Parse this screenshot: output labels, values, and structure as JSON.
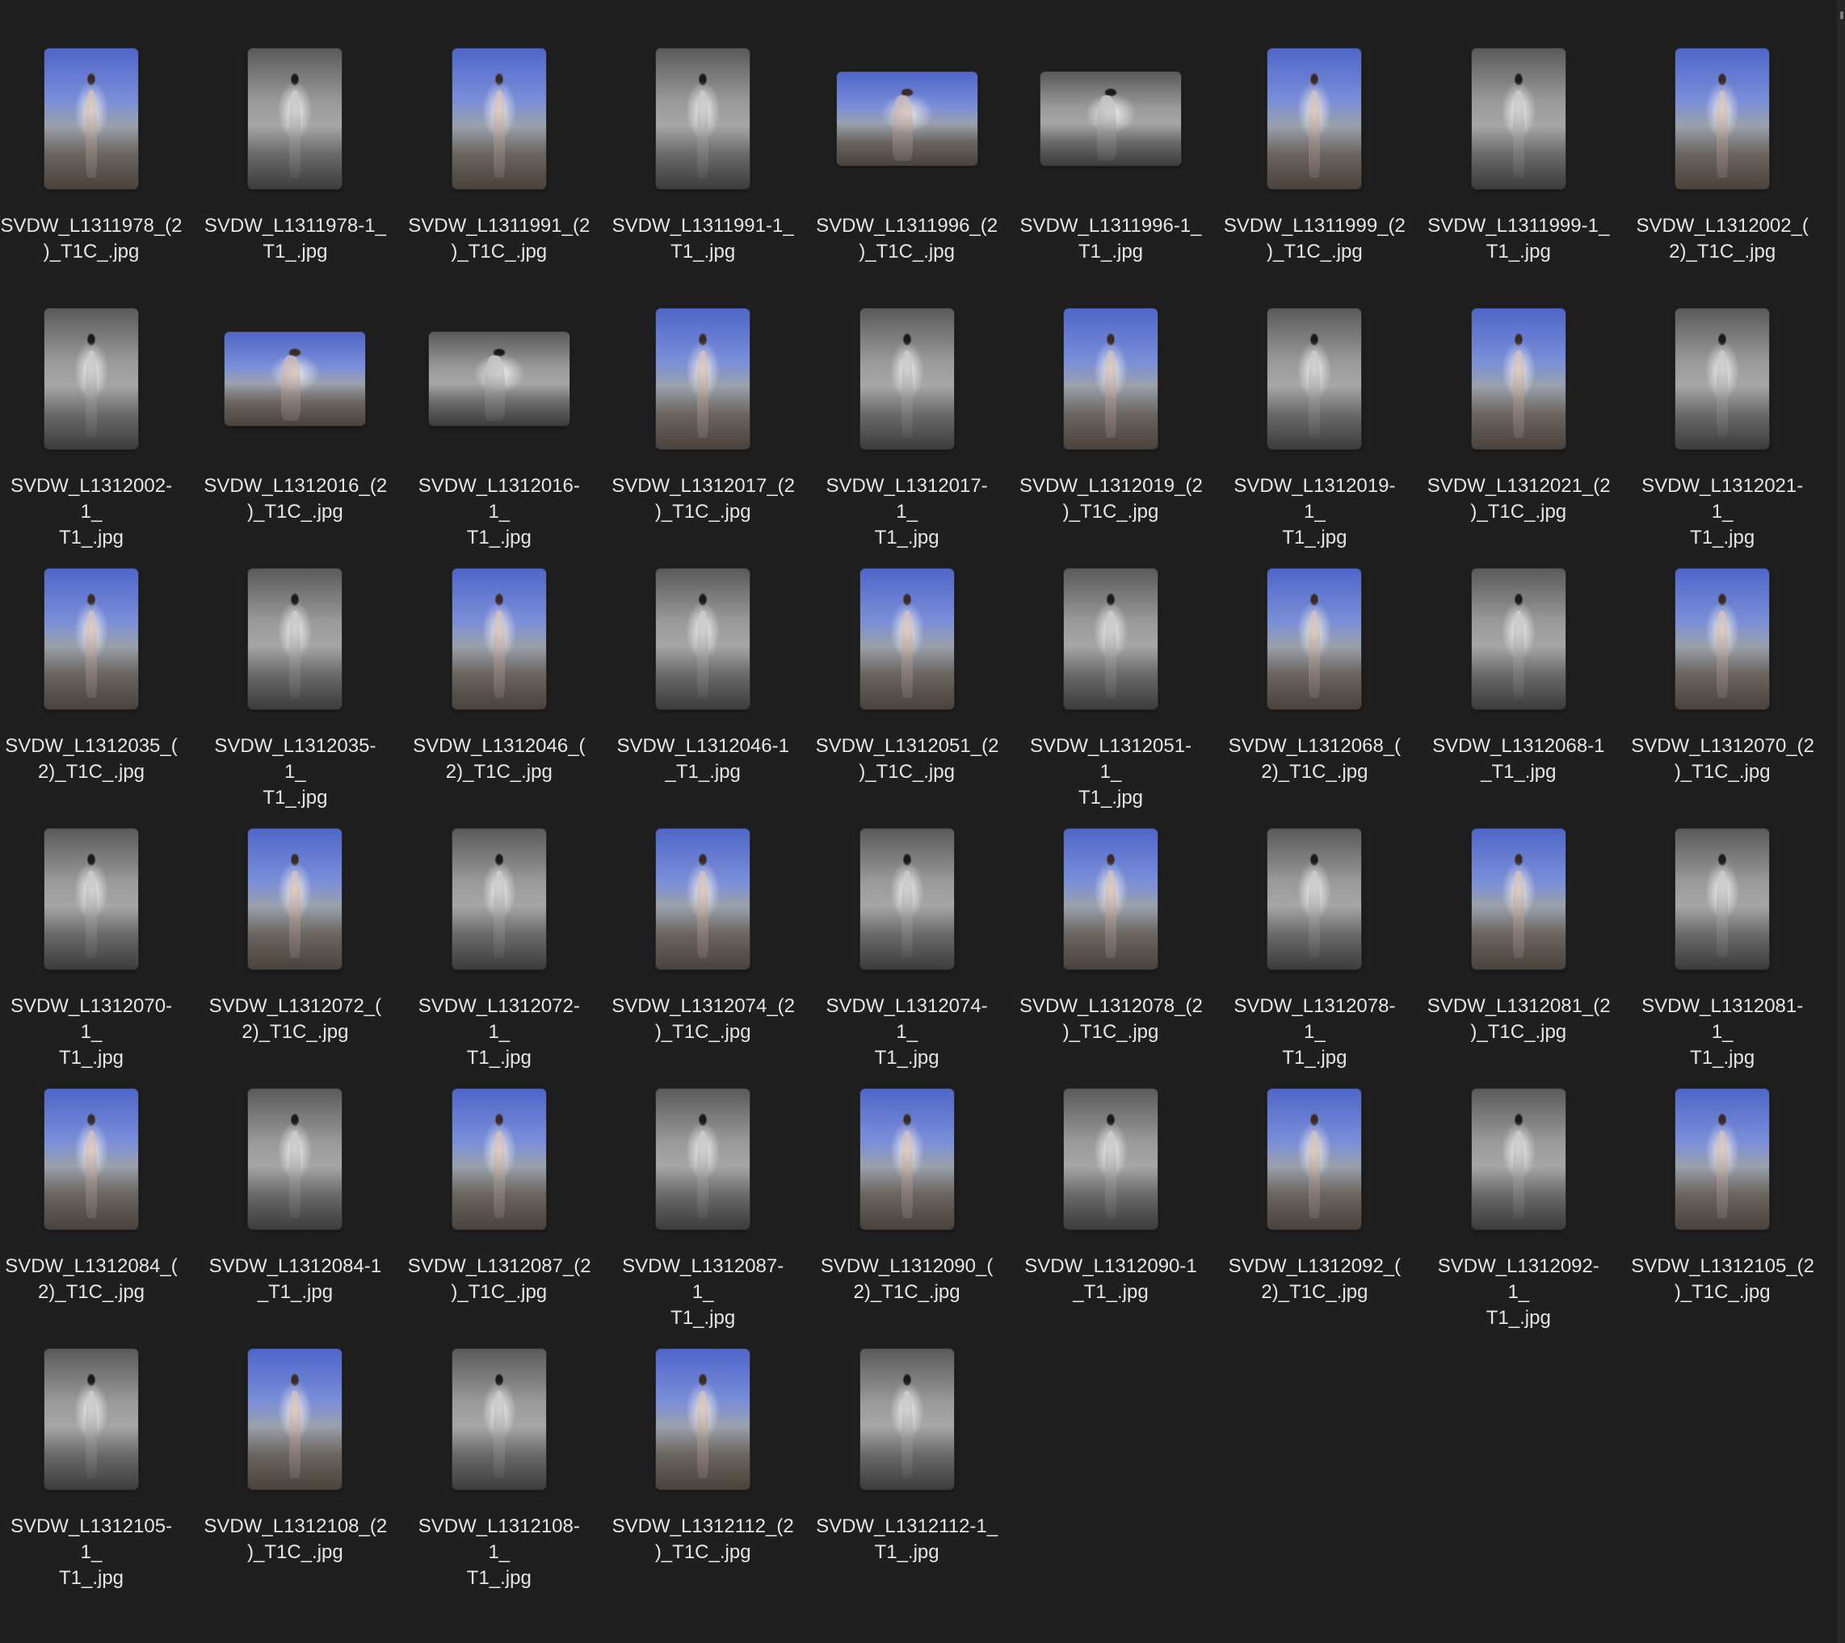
{
  "window": {
    "view": "icon-grid"
  },
  "files": [
    {
      "name": "SVDW_L1311978_(2)_T1C_.jpg",
      "label": "SVDW_L1311978_(2\n)_T1C_.jpg",
      "tone": "color",
      "orientation": "portrait"
    },
    {
      "name": "SVDW_L1311978-1_T1_.jpg",
      "label": "SVDW_L1311978-1_\nT1_.jpg",
      "tone": "bw",
      "orientation": "portrait"
    },
    {
      "name": "SVDW_L1311991_(2)_T1C_.jpg",
      "label": "SVDW_L1311991_(2\n)_T1C_.jpg",
      "tone": "color",
      "orientation": "portrait"
    },
    {
      "name": "SVDW_L1311991-1_T1_.jpg",
      "label": "SVDW_L1311991-1_\nT1_.jpg",
      "tone": "bw",
      "orientation": "portrait"
    },
    {
      "name": "SVDW_L1311996_(2)_T1C_.jpg",
      "label": "SVDW_L1311996_(2\n)_T1C_.jpg",
      "tone": "color",
      "orientation": "landscape"
    },
    {
      "name": "SVDW_L1311996-1_T1_.jpg",
      "label": "SVDW_L1311996-1_\nT1_.jpg",
      "tone": "bw",
      "orientation": "landscape"
    },
    {
      "name": "SVDW_L1311999_(2)_T1C_.jpg",
      "label": "SVDW_L1311999_(2\n)_T1C_.jpg",
      "tone": "color",
      "orientation": "portrait"
    },
    {
      "name": "SVDW_L1311999-1_T1_.jpg",
      "label": "SVDW_L1311999-1_\nT1_.jpg",
      "tone": "bw",
      "orientation": "portrait"
    },
    {
      "name": "SVDW_L1312002_(2)_T1C_.jpg",
      "label": "SVDW_L1312002_(\n2)_T1C_.jpg",
      "tone": "color",
      "orientation": "portrait"
    },
    {
      "name": "SVDW_L1312002-1_T1_.jpg",
      "label": "SVDW_L1312002-1_\nT1_.jpg",
      "tone": "bw",
      "orientation": "portrait"
    },
    {
      "name": "SVDW_L1312016_(2)_T1C_.jpg",
      "label": "SVDW_L1312016_(2\n)_T1C_.jpg",
      "tone": "color",
      "orientation": "landscape"
    },
    {
      "name": "SVDW_L1312016-1_T1_.jpg",
      "label": "SVDW_L1312016-1_\nT1_.jpg",
      "tone": "bw",
      "orientation": "landscape"
    },
    {
      "name": "SVDW_L1312017_(2)_T1C_.jpg",
      "label": "SVDW_L1312017_(2\n)_T1C_.jpg",
      "tone": "color",
      "orientation": "portrait"
    },
    {
      "name": "SVDW_L1312017-1_T1_.jpg",
      "label": "SVDW_L1312017-1_\nT1_.jpg",
      "tone": "bw",
      "orientation": "portrait"
    },
    {
      "name": "SVDW_L1312019_(2)_T1C_.jpg",
      "label": "SVDW_L1312019_(2\n)_T1C_.jpg",
      "tone": "color",
      "orientation": "portrait"
    },
    {
      "name": "SVDW_L1312019-1_T1_.jpg",
      "label": "SVDW_L1312019-1_\nT1_.jpg",
      "tone": "bw",
      "orientation": "portrait"
    },
    {
      "name": "SVDW_L1312021_(2)_T1C_.jpg",
      "label": "SVDW_L1312021_(2\n)_T1C_.jpg",
      "tone": "color",
      "orientation": "portrait"
    },
    {
      "name": "SVDW_L1312021-1_T1_.jpg",
      "label": "SVDW_L1312021-1_\nT1_.jpg",
      "tone": "bw",
      "orientation": "portrait"
    },
    {
      "name": "SVDW_L1312035_(2)_T1C_.jpg",
      "label": "SVDW_L1312035_(\n2)_T1C_.jpg",
      "tone": "color",
      "orientation": "portrait"
    },
    {
      "name": "SVDW_L1312035-1_T1_.jpg",
      "label": "SVDW_L1312035-1_\nT1_.jpg",
      "tone": "bw",
      "orientation": "portrait"
    },
    {
      "name": "SVDW_L1312046_(2)_T1C_.jpg",
      "label": "SVDW_L1312046_(\n2)_T1C_.jpg",
      "tone": "color",
      "orientation": "portrait"
    },
    {
      "name": "SVDW_L1312046-1_T1_.jpg",
      "label": "SVDW_L1312046-1\n_T1_.jpg",
      "tone": "bw",
      "orientation": "portrait"
    },
    {
      "name": "SVDW_L1312051_(2)_T1C_.jpg",
      "label": "SVDW_L1312051_(2\n)_T1C_.jpg",
      "tone": "color",
      "orientation": "portrait"
    },
    {
      "name": "SVDW_L1312051-1_T1_.jpg",
      "label": "SVDW_L1312051-1_\nT1_.jpg",
      "tone": "bw",
      "orientation": "portrait"
    },
    {
      "name": "SVDW_L1312068_(2)_T1C_.jpg",
      "label": "SVDW_L1312068_(\n2)_T1C_.jpg",
      "tone": "color",
      "orientation": "portrait"
    },
    {
      "name": "SVDW_L1312068-1_T1_.jpg",
      "label": "SVDW_L1312068-1\n_T1_.jpg",
      "tone": "bw",
      "orientation": "portrait"
    },
    {
      "name": "SVDW_L1312070_(2)_T1C_.jpg",
      "label": "SVDW_L1312070_(2\n)_T1C_.jpg",
      "tone": "color",
      "orientation": "portrait"
    },
    {
      "name": "SVDW_L1312070-1_T1_.jpg",
      "label": "SVDW_L1312070-1_\nT1_.jpg",
      "tone": "bw",
      "orientation": "portrait"
    },
    {
      "name": "SVDW_L1312072_(2)_T1C_.jpg",
      "label": "SVDW_L1312072_(\n2)_T1C_.jpg",
      "tone": "color",
      "orientation": "portrait"
    },
    {
      "name": "SVDW_L1312072-1_T1_.jpg",
      "label": "SVDW_L1312072-1_\nT1_.jpg",
      "tone": "bw",
      "orientation": "portrait"
    },
    {
      "name": "SVDW_L1312074_(2)_T1C_.jpg",
      "label": "SVDW_L1312074_(2\n)_T1C_.jpg",
      "tone": "color",
      "orientation": "portrait"
    },
    {
      "name": "SVDW_L1312074-1_T1_.jpg",
      "label": "SVDW_L1312074-1_\nT1_.jpg",
      "tone": "bw",
      "orientation": "portrait"
    },
    {
      "name": "SVDW_L1312078_(2)_T1C_.jpg",
      "label": "SVDW_L1312078_(2\n)_T1C_.jpg",
      "tone": "color",
      "orientation": "portrait"
    },
    {
      "name": "SVDW_L1312078-1_T1_.jpg",
      "label": "SVDW_L1312078-1_\nT1_.jpg",
      "tone": "bw",
      "orientation": "portrait"
    },
    {
      "name": "SVDW_L1312081_(2)_T1C_.jpg",
      "label": "SVDW_L1312081_(2\n)_T1C_.jpg",
      "tone": "color",
      "orientation": "portrait"
    },
    {
      "name": "SVDW_L1312081-1_T1_.jpg",
      "label": "SVDW_L1312081-1_\nT1_.jpg",
      "tone": "bw",
      "orientation": "portrait"
    },
    {
      "name": "SVDW_L1312084_(2)_T1C_.jpg",
      "label": "SVDW_L1312084_(\n2)_T1C_.jpg",
      "tone": "color",
      "orientation": "portrait"
    },
    {
      "name": "SVDW_L1312084-1_T1_.jpg",
      "label": "SVDW_L1312084-1\n_T1_.jpg",
      "tone": "bw",
      "orientation": "portrait"
    },
    {
      "name": "SVDW_L1312087_(2)_T1C_.jpg",
      "label": "SVDW_L1312087_(2\n)_T1C_.jpg",
      "tone": "color",
      "orientation": "portrait"
    },
    {
      "name": "SVDW_L1312087-1_T1_.jpg",
      "label": "SVDW_L1312087-1_\nT1_.jpg",
      "tone": "bw",
      "orientation": "portrait"
    },
    {
      "name": "SVDW_L1312090_(2)_T1C_.jpg",
      "label": "SVDW_L1312090_(\n2)_T1C_.jpg",
      "tone": "color",
      "orientation": "portrait"
    },
    {
      "name": "SVDW_L1312090-1_T1_.jpg",
      "label": "SVDW_L1312090-1\n_T1_.jpg",
      "tone": "bw",
      "orientation": "portrait"
    },
    {
      "name": "SVDW_L1312092_(2)_T1C_.jpg",
      "label": "SVDW_L1312092_(\n2)_T1C_.jpg",
      "tone": "color",
      "orientation": "portrait"
    },
    {
      "name": "SVDW_L1312092-1_T1_.jpg",
      "label": "SVDW_L1312092-1_\nT1_.jpg",
      "tone": "bw",
      "orientation": "portrait"
    },
    {
      "name": "SVDW_L1312105_(2)_T1C_.jpg",
      "label": "SVDW_L1312105_(2\n)_T1C_.jpg",
      "tone": "color",
      "orientation": "portrait"
    },
    {
      "name": "SVDW_L1312105-1_T1_.jpg",
      "label": "SVDW_L1312105-1_\nT1_.jpg",
      "tone": "bw",
      "orientation": "portrait"
    },
    {
      "name": "SVDW_L1312108_(2)_T1C_.jpg",
      "label": "SVDW_L1312108_(2\n)_T1C_.jpg",
      "tone": "color",
      "orientation": "portrait"
    },
    {
      "name": "SVDW_L1312108-1_T1_.jpg",
      "label": "SVDW_L1312108-1_\nT1_.jpg",
      "tone": "bw",
      "orientation": "portrait"
    },
    {
      "name": "SVDW_L1312112_(2)_T1C_.jpg",
      "label": "SVDW_L1312112_(2\n)_T1C_.jpg",
      "tone": "color",
      "orientation": "portrait"
    },
    {
      "name": "SVDW_L1312112-1_T1_.jpg",
      "label": "SVDW_L1312112-1_\nT1_.jpg",
      "tone": "bw",
      "orientation": "portrait"
    }
  ],
  "colors": {
    "background": "#1f1f20",
    "label_text": "#e6e6e6"
  }
}
